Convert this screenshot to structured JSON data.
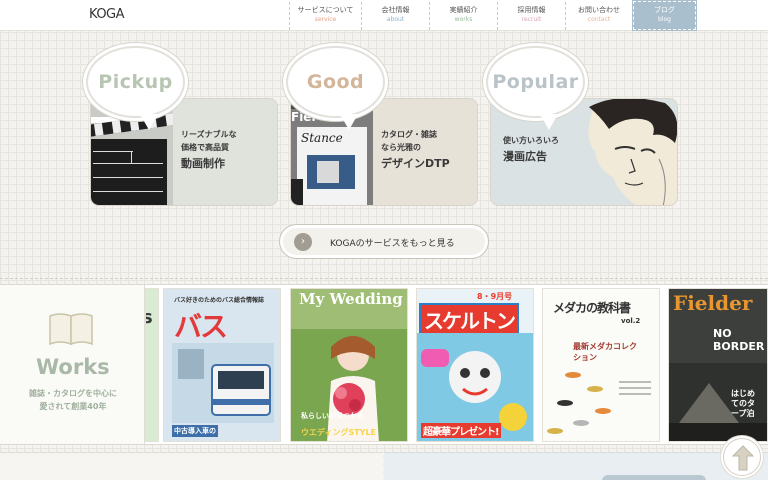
{
  "header": {
    "logo": "KOGA",
    "nav": [
      {
        "jp": "サービスについて",
        "en": "service",
        "color": "#e7a38b"
      },
      {
        "jp": "会社情報",
        "en": "about",
        "color": "#8bb1c8"
      },
      {
        "jp": "実績紹介",
        "en": "works",
        "color": "#97b89a"
      },
      {
        "jp": "採用情報",
        "en": "recruit",
        "color": "#d9a3b8"
      },
      {
        "jp": "お問い合わせ",
        "en": "contact",
        "color": "#e5b596"
      },
      {
        "jp": "ブログ",
        "en": "blog",
        "color": "#ffffff"
      }
    ]
  },
  "cards": [
    {
      "bubble": "Pickup",
      "bubble_color": "#b7c5b2",
      "bg": "#dfe3db",
      "line1": "リーズナブルな",
      "line2": "価格で高品質",
      "big": "動画制作"
    },
    {
      "bubble": "Good",
      "bubble_color": "#d3b59a",
      "bg": "#e6e2d8",
      "line1": "カタログ・雑誌",
      "line2": "なら光雅の",
      "big": "デザインDTP"
    },
    {
      "bubble": "Popular",
      "bubble_color": "#b9c3c8",
      "bg": "#dbe2e4",
      "line1": "使い方いろいろ",
      "line2": "",
      "big": "漫画広告"
    }
  ],
  "more_button": "KOGAのサービスをもっと見る",
  "works": {
    "title": "Works",
    "sub1": "雑誌・カタログを中心に",
    "sub2": "愛されて創業40年"
  },
  "magazines": [
    {
      "title": "バス",
      "subtitle": "バス好きのためのバス総合情報誌",
      "note": "中古導入車の",
      "bg": "#d9e6ef"
    },
    {
      "title": "My Wedding",
      "subtitle": "私らしいが見つかる",
      "note": "ウエディングSTYLE",
      "bg": "#f2d9d3"
    },
    {
      "title": "スケルトン",
      "subtitle": "8・9月号",
      "note": "超豪華プレゼント!",
      "bg": "#e9f2f6"
    },
    {
      "title": "メダカの教科書",
      "subtitle": "vol.2",
      "note": "最新メダカコレクション",
      "bg": "#fbfbf8"
    },
    {
      "title": "Fielder",
      "subtitle": "NO BORDER",
      "note": "はじめてのタープ泊",
      "bg": "#3d3f3c"
    }
  ]
}
